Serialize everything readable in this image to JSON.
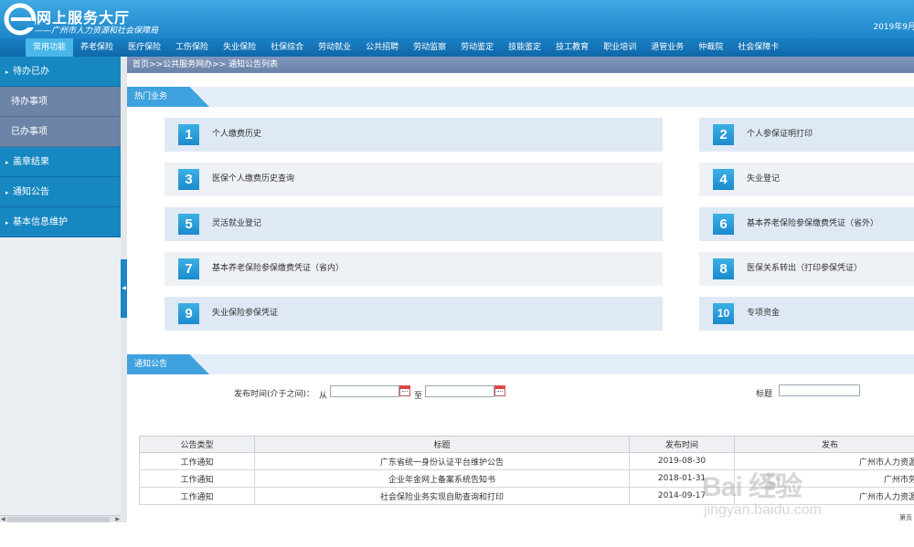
{
  "header": {
    "logo_title": "网上服务大厅",
    "logo_subtitle": "——广州市人力资源和社会保障局",
    "date": "2019年9月"
  },
  "nav": {
    "items": [
      "常用功能",
      "养老保险",
      "医疗保险",
      "工伤保险",
      "失业保险",
      "社保综合",
      "劳动就业",
      "公共招聘",
      "劳动监察",
      "劳动鉴定",
      "技能鉴定",
      "技工教育",
      "职业培训",
      "退管业务",
      "仲裁院",
      "社会保障卡"
    ],
    "active_index": 0
  },
  "sidebar": {
    "group1": "待办已办",
    "sub1": "待办事项",
    "sub2": "已办事项",
    "group2": "盖章结果",
    "group3": "通知公告",
    "group4": "基本信息维护"
  },
  "breadcrumb": "首页>>公共服务网办>> 通知公告列表",
  "hot": {
    "title": "热门业务",
    "items": [
      {
        "num": "1",
        "label": "个人缴费历史"
      },
      {
        "num": "2",
        "label": "个人参保证明打印"
      },
      {
        "num": "3",
        "label": "医保个人缴费历史查询"
      },
      {
        "num": "4",
        "label": "失业登记"
      },
      {
        "num": "5",
        "label": "灵活就业登记"
      },
      {
        "num": "6",
        "label": "基本养老保险参保缴费凭证（省外）"
      },
      {
        "num": "7",
        "label": "基本养老保险参保缴费凭证（省内）"
      },
      {
        "num": "8",
        "label": "医保关系转出（打印参保凭证）"
      },
      {
        "num": "9",
        "label": "失业保险参保凭证"
      },
      {
        "num": "10",
        "label": "专项资金"
      }
    ]
  },
  "notice": {
    "title": "通知公告",
    "filter": {
      "time_label": "发布时间(介于之间)：",
      "from_label": "从",
      "to_label": "至",
      "from_value": "",
      "to_value": "",
      "title_label": "标题",
      "title_value": ""
    },
    "columns": [
      "公告类型",
      "标题",
      "发布时间",
      "发布"
    ],
    "rows": [
      [
        "工作通知",
        "广东省统一身份认证平台维护公告",
        "2019-08-30",
        "广州市人力资源和"
      ],
      [
        "工作通知",
        "企业年金网上备案系统告知书",
        "2018-01-31",
        "广州市劳动"
      ],
      [
        "工作通知",
        "社会保险业务实现自助查询和打印",
        "2014-09-17",
        "广州市人力资源和"
      ]
    ],
    "pager_hint": "第页"
  },
  "watermark": {
    "main": "Bai 经验",
    "sub": "jingyan.baidu.com"
  }
}
